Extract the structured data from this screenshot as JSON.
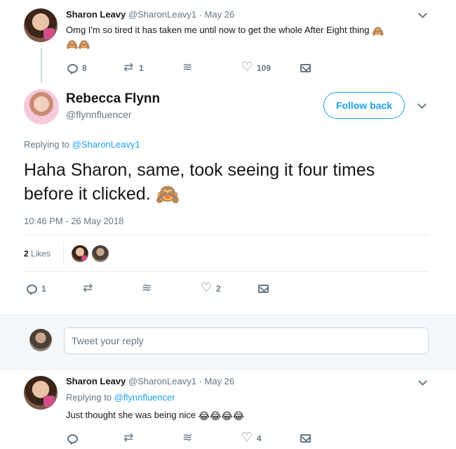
{
  "tweet1": {
    "name": "Sharon Leavy",
    "handle": "@SharonLeavy1",
    "date": "· May 26",
    "text": "Omg I'm so tired it has taken me until now to get the whole After Eight thing",
    "emoji_inline": "🙈",
    "emoji_line2": "🙈🙈",
    "replies": "8",
    "retweets": "1",
    "likes": "109"
  },
  "main": {
    "name": "Rebecca Flynn",
    "handle": "@flynnfluencer",
    "follow_label": "Follow back",
    "replying_prefix": "Replying to",
    "replying_to": "@SharonLeavy1",
    "text_line1": "Haha Sharon, same, took seeing it four times",
    "text_line2": "before it clicked.",
    "emoji": "🙈",
    "timestamp": "10:46 PM - 26 May 2018",
    "likes_count": "2",
    "likes_label": "Likes",
    "replies": "1",
    "likes": "2"
  },
  "compose": {
    "placeholder": "Tweet your reply"
  },
  "tweet2": {
    "name": "Sharon Leavy",
    "handle": "@SharonLeavy1",
    "date": "· May 26",
    "replying_prefix": "Replying to",
    "replying_to": "@flynnfluencer",
    "text": "Just thought she was being nice",
    "emoji": "😂😂😂😂",
    "likes": "4"
  }
}
